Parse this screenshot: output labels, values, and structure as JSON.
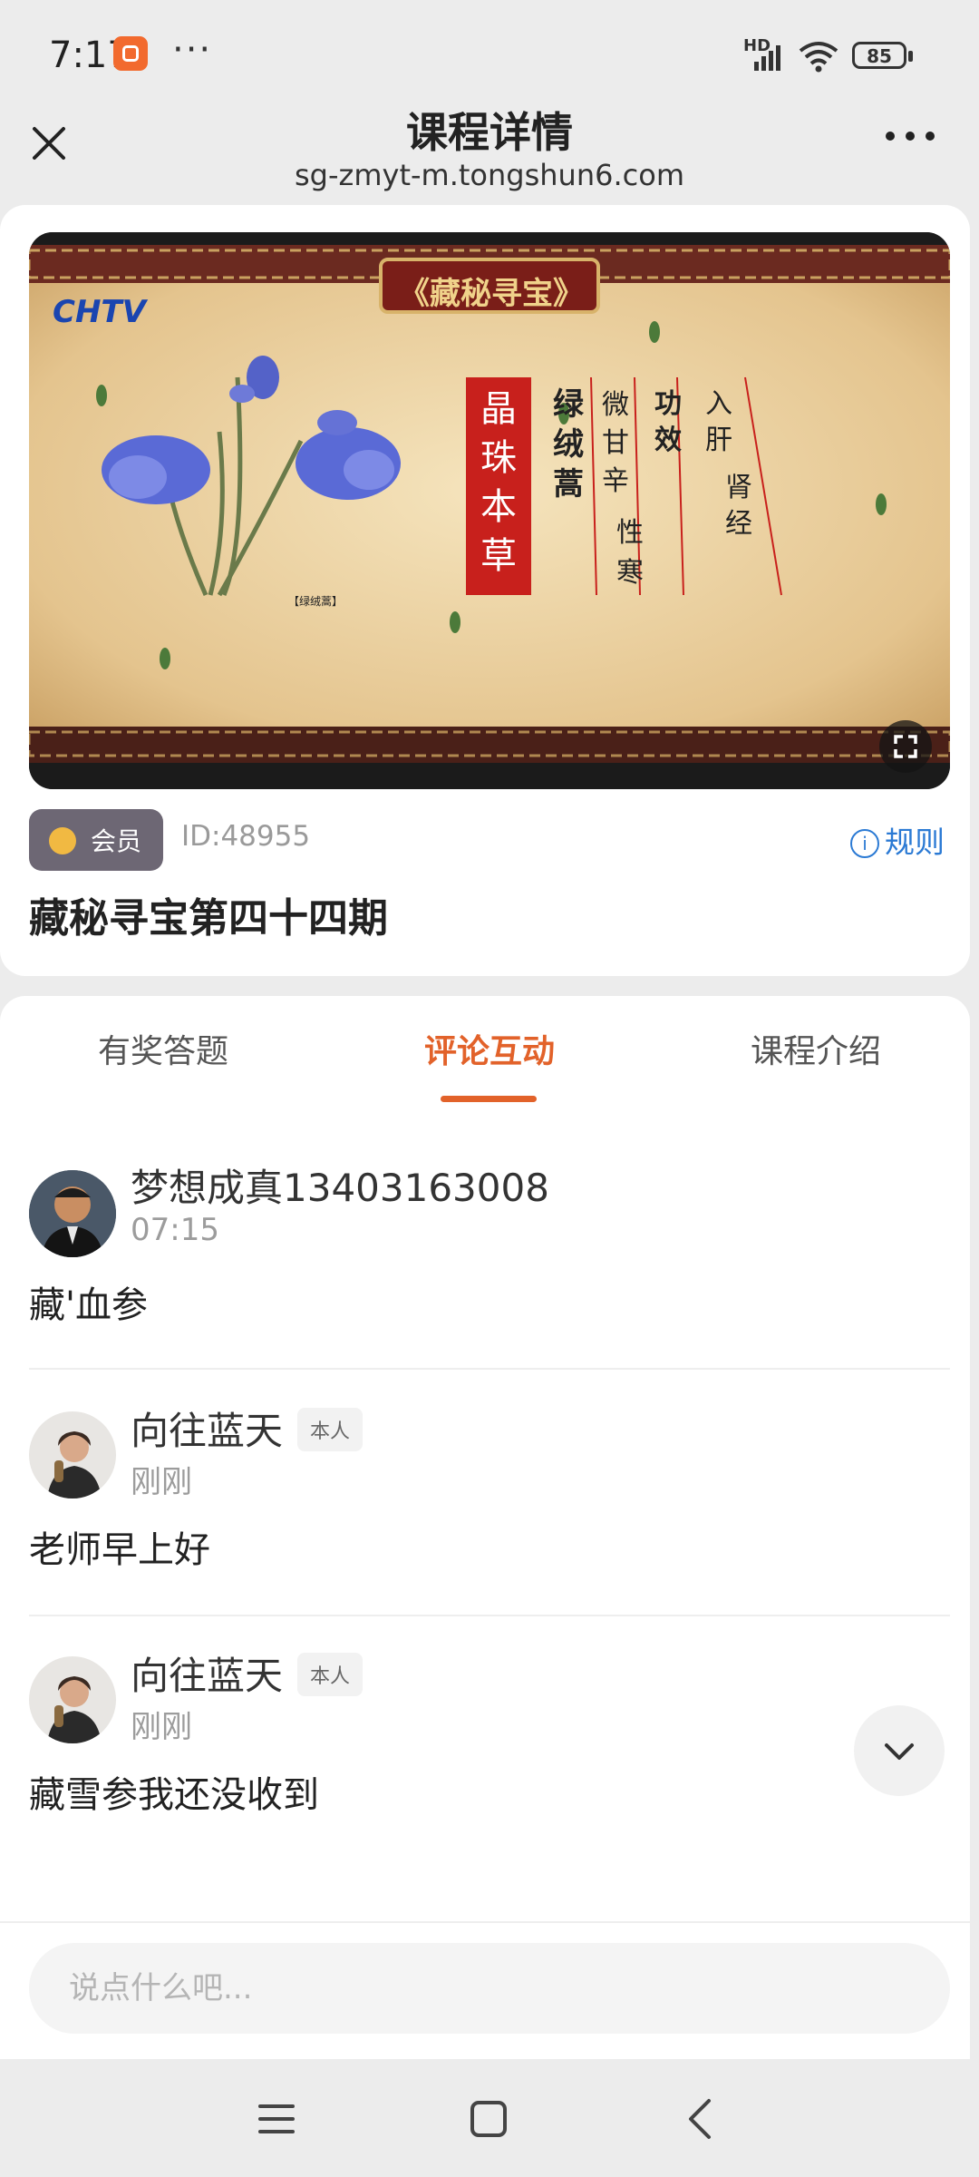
{
  "status_bar": {
    "time": "7:17",
    "dots": "···",
    "network": "HD",
    "battery": "85"
  },
  "header": {
    "title": "课程详情",
    "url": "sg-zmyt-m.tongshun6.com"
  },
  "video": {
    "brand": "CHTV",
    "banner": "《藏秘寻宝》",
    "red_title": "晶珠本草",
    "plant_name": "绿绒蒿",
    "col1": "微甘辛",
    "col2": "性寒",
    "col3": "功效",
    "col4": "入肝",
    "col5": "肾经",
    "caption": "【绿绒蒿】"
  },
  "course": {
    "member_label": "会员",
    "id_label": "ID:48955",
    "rules_label": "规则",
    "title": "藏秘寻宝第四十四期"
  },
  "tabs": [
    {
      "label": "有奖答题"
    },
    {
      "label": "评论互动"
    },
    {
      "label": "课程介绍"
    }
  ],
  "comments": [
    {
      "name": "梦想成真13403163008",
      "time": "07:15",
      "text": "藏'血参",
      "tag": ""
    },
    {
      "name": "向往蓝天",
      "time": "刚刚",
      "text": "老师早上好",
      "tag": "本人"
    },
    {
      "name": "向往蓝天",
      "time": "刚刚",
      "text": "藏雪参我还没收到",
      "tag": "本人"
    }
  ],
  "input": {
    "placeholder": "说点什么吧..."
  },
  "colors": {
    "accent": "#e2622a",
    "link": "#2b7ad4",
    "member_badge": "#6d6774"
  }
}
